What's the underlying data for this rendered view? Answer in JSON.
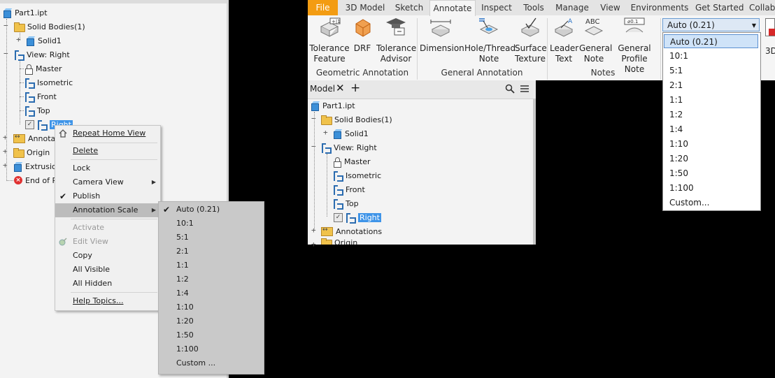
{
  "left_tree": [
    {
      "label": "Part1.ipt",
      "icon": "part-icon"
    },
    {
      "label": "Solid Bodies(1)",
      "icon": "folder-icon",
      "toggle": "−"
    },
    {
      "label": "Solid1",
      "icon": "solid-icon",
      "toggle": "+"
    },
    {
      "label": "View: Right",
      "icon": "view-icon",
      "toggle": "−"
    },
    {
      "label": "Master",
      "icon": "lock-icon"
    },
    {
      "label": "Isometric",
      "icon": "view-icon"
    },
    {
      "label": "Front",
      "icon": "view-icon"
    },
    {
      "label": "Top",
      "icon": "view-icon"
    },
    {
      "label": "Right",
      "icon": "view-icon"
    },
    {
      "label": "Annotati",
      "icon": "annotation-folder-icon",
      "toggle": "+"
    },
    {
      "label": "Origin",
      "icon": "folder-icon",
      "toggle": "+"
    },
    {
      "label": "Extrusion1",
      "icon": "extrusion-icon",
      "toggle": "+"
    },
    {
      "label": "End of P",
      "icon": "error-icon"
    }
  ],
  "context_menu": {
    "items": [
      {
        "label": "Repeat Home View",
        "icon": "home-icon"
      },
      {
        "label": "Delete"
      },
      {
        "label": "Lock"
      },
      {
        "label": "Camera View",
        "submenu": true
      },
      {
        "label": "Publish",
        "checked": true
      },
      {
        "label": "Annotation Scale",
        "submenu": true,
        "highlighted": true
      },
      {
        "label": "Activate",
        "disabled": true
      },
      {
        "label": "Edit View",
        "disabled": true,
        "icon": "edit-view-icon"
      },
      {
        "label": "Copy"
      },
      {
        "label": "All Visible"
      },
      {
        "label": "All Hidden"
      },
      {
        "label": "Help Topics..."
      }
    ]
  },
  "annotation_scale_submenu": {
    "items": [
      "Auto (0.21)",
      "10:1",
      "5:1",
      "2:1",
      "1:1",
      "1:2",
      "1:4",
      "1:10",
      "1:20",
      "1:50",
      "1:100",
      "Custom ..."
    ],
    "checked": "Auto (0.21)"
  },
  "ribbon": {
    "tabs": [
      "File",
      "3D Model",
      "Sketch",
      "Annotate",
      "Inspect",
      "Tools",
      "Manage",
      "View",
      "Environments",
      "Get Started",
      "Collab"
    ],
    "active_tab": "Annotate",
    "buttons": [
      {
        "line1": "Tolerance",
        "line2": "Feature"
      },
      {
        "line1": "DRF",
        "line2": ""
      },
      {
        "line1": "Tolerance",
        "line2": "Advisor"
      },
      {
        "line1": "Dimension",
        "line2": ""
      },
      {
        "line1": "Hole/Thread",
        "line2": "Note"
      },
      {
        "line1": "Surface",
        "line2": "Texture"
      },
      {
        "line1": "Leader",
        "line2": "Text"
      },
      {
        "line1": "General",
        "line2": "Note"
      },
      {
        "line1": "General",
        "line2": "Profile Note"
      }
    ],
    "icon_texts": {
      "tolerance_feature": "+|1",
      "leader_text": "A",
      "general_note": "ABC",
      "general_profile_note": "⌀0.1"
    },
    "groups": [
      "Geometric Annotation",
      "General Annotation",
      "Notes"
    ],
    "scale_combo": {
      "value": "Auto (0.21)"
    },
    "scale_options": [
      "Auto (0.21)",
      "10:1",
      "5:1",
      "2:1",
      "1:1",
      "1:2",
      "1:4",
      "1:10",
      "1:20",
      "1:50",
      "1:100",
      "Custom..."
    ],
    "far_right_label": "3D"
  },
  "right_browser": {
    "tab_label": "Model",
    "tree": [
      {
        "label": "Part1.ipt"
      },
      {
        "label": "Solid Bodies(1)",
        "toggle": "−"
      },
      {
        "label": "Solid1",
        "toggle": "+"
      },
      {
        "label": "View: Right",
        "toggle": "−"
      },
      {
        "label": "Master"
      },
      {
        "label": "Isometric"
      },
      {
        "label": "Front"
      },
      {
        "label": "Top"
      },
      {
        "label": "Right"
      },
      {
        "label": "Annotations",
        "toggle": "+"
      },
      {
        "label": "Origin",
        "toggle": "+"
      }
    ]
  }
}
